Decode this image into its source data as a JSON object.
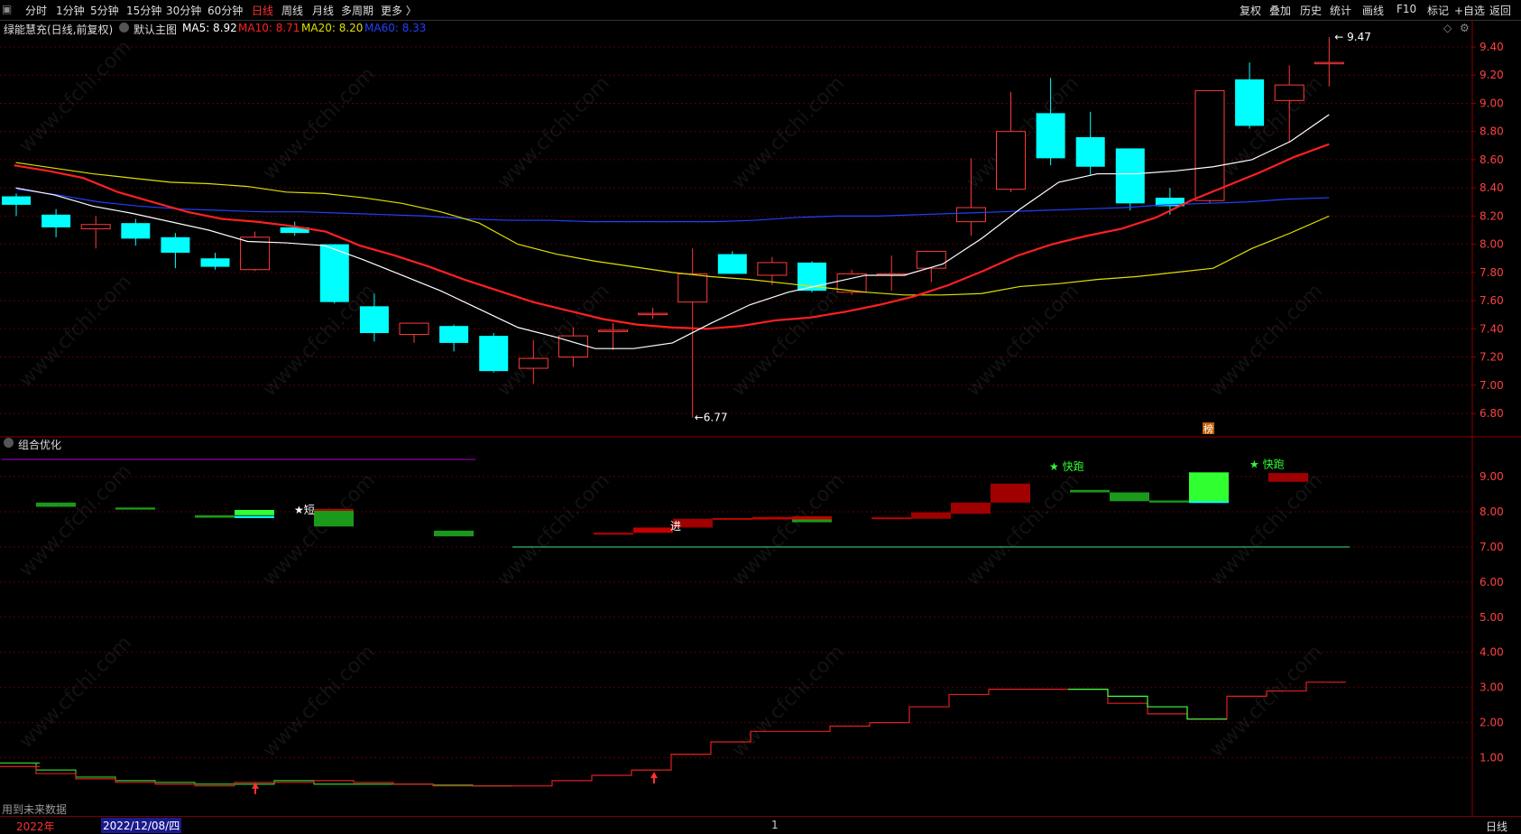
{
  "topbar": {
    "tabs": [
      "分时",
      "1分钟",
      "5分钟",
      "15分钟",
      "30分钟",
      "60分钟",
      "日线",
      "周线",
      "月线",
      "多周期",
      "更多 〉"
    ],
    "active_tab": "日线",
    "right_buttons": [
      "复权",
      "叠加",
      "历史",
      "统计",
      "画线",
      "F10",
      "标记",
      "+自选",
      "返回"
    ]
  },
  "main": {
    "title": "绿能慧充(日线,前复权)",
    "overlay": "默认主图",
    "ma5": "MA5: 8.92",
    "ma10": "MA10: 8.71",
    "ma20": "MA20: 8.20",
    "ma60": "MA60: 8.33",
    "high_label": "9.47",
    "low_label": "6.77",
    "marker": "榜",
    "yticks": [
      "9.40",
      "9.20",
      "9.00",
      "8.80",
      "8.60",
      "8.40",
      "8.20",
      "8.00",
      "7.80",
      "7.60",
      "7.40",
      "7.20",
      "7.00",
      "6.80"
    ]
  },
  "indicator": {
    "title": "组合优化",
    "labels": {
      "short": "★短",
      "entry": "进",
      "fast1": "★ 快跑",
      "fast2": "★ 快跑"
    },
    "yticks": [
      "9.00",
      "8.00",
      "7.00",
      "6.00",
      "5.00",
      "4.00",
      "3.00",
      "2.00",
      "1.00"
    ],
    "footnote": "用到未来数据"
  },
  "bottom": {
    "year": "2022年",
    "date": "2022/12/08/四",
    "mark": "1",
    "period": "日线"
  },
  "watermark": "www.cfchi.com",
  "colors": {
    "up": "#ff3b3b",
    "down": "#00ffff",
    "ma5": "#ffffff",
    "ma10": "#ff2020",
    "ma20": "#e0e000",
    "ma60": "#2040ff",
    "bg": "#000000",
    "grid": "#5a0000"
  },
  "chart_data": {
    "type": "candlestick",
    "candles": [
      {
        "o": 8.34,
        "h": 8.36,
        "l": 8.2,
        "c": 8.28
      },
      {
        "o": 8.21,
        "h": 8.25,
        "l": 8.05,
        "c": 8.12
      },
      {
        "o": 8.11,
        "h": 8.2,
        "l": 7.97,
        "c": 8.14
      },
      {
        "o": 8.15,
        "h": 8.18,
        "l": 7.99,
        "c": 8.04
      },
      {
        "o": 8.05,
        "h": 8.08,
        "l": 7.83,
        "c": 7.94
      },
      {
        "o": 7.9,
        "h": 7.94,
        "l": 7.82,
        "c": 7.84
      },
      {
        "o": 7.82,
        "h": 8.09,
        "l": 7.81,
        "c": 8.05
      },
      {
        "o": 8.12,
        "h": 8.16,
        "l": 8.06,
        "c": 8.08
      },
      {
        "o": 8.0,
        "h": 8.0,
        "l": 7.58,
        "c": 7.59
      },
      {
        "o": 7.56,
        "h": 7.65,
        "l": 7.31,
        "c": 7.37
      },
      {
        "o": 7.36,
        "h": 7.44,
        "l": 7.3,
        "c": 7.44
      },
      {
        "o": 7.42,
        "h": 7.43,
        "l": 7.24,
        "c": 7.3
      },
      {
        "o": 7.35,
        "h": 7.37,
        "l": 7.09,
        "c": 7.1
      },
      {
        "o": 7.12,
        "h": 7.32,
        "l": 7.01,
        "c": 7.19
      },
      {
        "o": 7.2,
        "h": 7.41,
        "l": 7.13,
        "c": 7.35
      },
      {
        "o": 7.39,
        "h": 7.44,
        "l": 7.25,
        "c": 7.39
      },
      {
        "o": 7.51,
        "h": 7.55,
        "l": 7.47,
        "c": 7.51
      },
      {
        "o": 7.59,
        "h": 7.97,
        "l": 6.77,
        "c": 7.79
      },
      {
        "o": 7.93,
        "h": 7.95,
        "l": 7.79,
        "c": 7.79
      },
      {
        "o": 7.78,
        "h": 7.91,
        "l": 7.71,
        "c": 7.87
      },
      {
        "o": 7.87,
        "h": 7.88,
        "l": 7.66,
        "c": 7.67
      },
      {
        "o": 7.66,
        "h": 7.82,
        "l": 7.64,
        "c": 7.79
      },
      {
        "o": 7.79,
        "h": 7.92,
        "l": 7.67,
        "c": 7.79
      },
      {
        "o": 7.83,
        "h": 7.95,
        "l": 7.73,
        "c": 7.95
      },
      {
        "o": 8.16,
        "h": 8.61,
        "l": 8.06,
        "c": 8.26
      },
      {
        "o": 8.39,
        "h": 9.08,
        "l": 8.37,
        "c": 8.8
      },
      {
        "o": 8.93,
        "h": 9.18,
        "l": 8.56,
        "c": 8.61
      },
      {
        "o": 8.76,
        "h": 8.94,
        "l": 8.49,
        "c": 8.55
      },
      {
        "o": 8.68,
        "h": 8.68,
        "l": 8.24,
        "c": 8.29
      },
      {
        "o": 8.33,
        "h": 8.4,
        "l": 8.21,
        "c": 8.27
      },
      {
        "o": 8.31,
        "h": 9.09,
        "l": 8.29,
        "c": 9.09
      },
      {
        "o": 9.17,
        "h": 9.29,
        "l": 8.82,
        "c": 8.84
      },
      {
        "o": 9.02,
        "h": 9.27,
        "l": 8.72,
        "c": 9.13
      },
      {
        "o": 9.29,
        "h": 9.47,
        "l": 9.12,
        "c": 9.29
      }
    ],
    "ma5": [
      8.4,
      8.35,
      8.27,
      8.22,
      8.16,
      8.1,
      8.02,
      8.01,
      7.99,
      7.89,
      7.78,
      7.67,
      7.54,
      7.41,
      7.34,
      7.26,
      7.26,
      7.3,
      7.44,
      7.57,
      7.66,
      7.72,
      7.78,
      7.78,
      7.86,
      8.04,
      8.25,
      8.44,
      8.5,
      8.5,
      8.52,
      8.55,
      8.6,
      8.73,
      8.92
    ],
    "ma10": [
      8.56,
      8.52,
      8.47,
      8.37,
      8.3,
      8.23,
      8.18,
      8.16,
      8.13,
      8.09,
      7.99,
      7.92,
      7.84,
      7.75,
      7.67,
      7.59,
      7.53,
      7.47,
      7.43,
      7.41,
      7.4,
      7.42,
      7.46,
      7.48,
      7.52,
      7.57,
      7.63,
      7.71,
      7.81,
      7.92,
      8.0,
      8.06,
      8.11,
      8.19,
      8.31,
      8.41,
      8.51,
      8.62,
      8.71
    ],
    "ma20": [
      8.58,
      8.54,
      8.5,
      8.47,
      8.44,
      8.43,
      8.41,
      8.37,
      8.36,
      8.33,
      8.29,
      8.23,
      8.15,
      8.0,
      7.93,
      7.88,
      7.84,
      7.8,
      7.77,
      7.75,
      7.72,
      7.69,
      7.66,
      7.64,
      7.64,
      7.65,
      7.7,
      7.72,
      7.75,
      7.77,
      7.8,
      7.83,
      7.97,
      8.08,
      8.2
    ],
    "ma60": [
      8.39,
      8.35,
      8.3,
      8.27,
      8.25,
      8.24,
      8.23,
      8.23,
      8.22,
      8.21,
      8.2,
      8.18,
      8.17,
      8.17,
      8.16,
      8.16,
      8.16,
      8.16,
      8.17,
      8.19,
      8.2,
      8.2,
      8.21,
      8.22,
      8.23,
      8.24,
      8.25,
      8.26,
      8.28,
      8.29,
      8.3,
      8.32,
      8.33
    ]
  }
}
